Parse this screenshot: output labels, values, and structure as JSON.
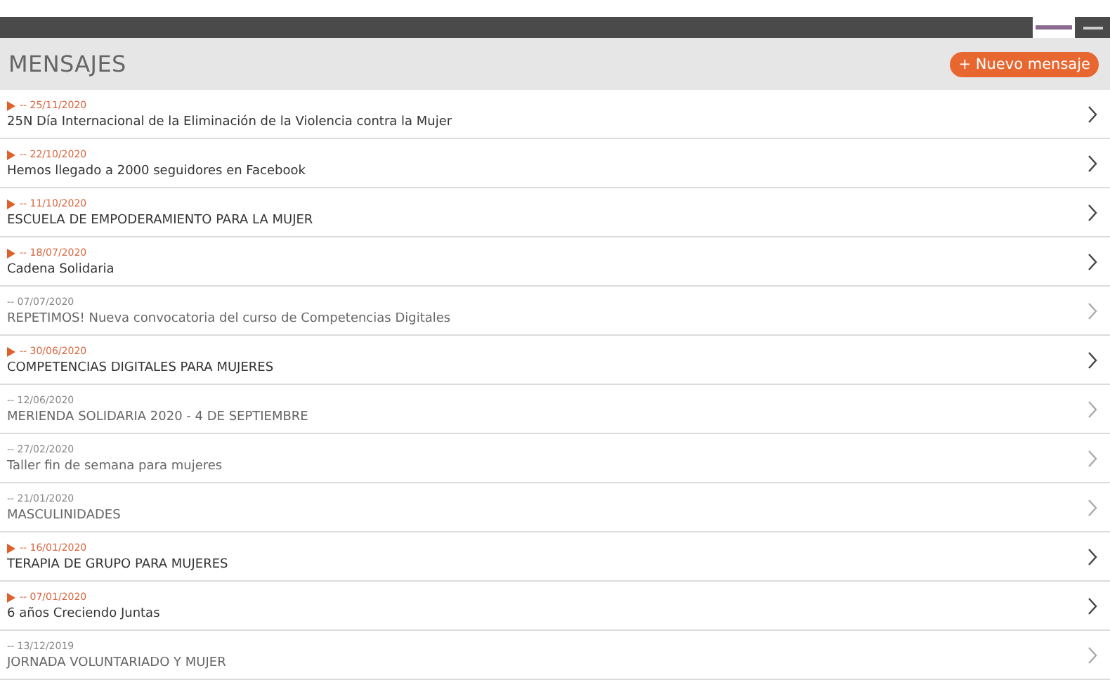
{
  "header": {
    "title": "MENSAJES",
    "new_button": "+ Nuevo mensaje"
  },
  "messages": [
    {
      "date": "-- 25/11/2020",
      "title": "25N Día Internacional de la Eliminación de la Violencia contra la Mujer",
      "unread": true
    },
    {
      "date": "-- 22/10/2020",
      "title": "Hemos llegado a 2000 seguidores en Facebook",
      "unread": true
    },
    {
      "date": "-- 11/10/2020",
      "title": "ESCUELA DE EMPODERAMIENTO PARA LA MUJER",
      "unread": true
    },
    {
      "date": "-- 18/07/2020",
      "title": "Cadena Solidaria",
      "unread": true
    },
    {
      "date": "-- 07/07/2020",
      "title": "REPETIMOS! Nueva convocatoria del curso de Competencias Digitales",
      "unread": false
    },
    {
      "date": "-- 30/06/2020",
      "title": "COMPETENCIAS DIGITALES PARA MUJERES",
      "unread": true
    },
    {
      "date": "-- 12/06/2020",
      "title": "MERIENDA SOLIDARIA 2020 - 4 DE SEPTIEMBRE",
      "unread": false
    },
    {
      "date": "-- 27/02/2020",
      "title": "Taller fin de semana para mujeres",
      "unread": false
    },
    {
      "date": "-- 21/01/2020",
      "title": "MASCULINIDADES",
      "unread": false
    },
    {
      "date": "-- 16/01/2020",
      "title": "TERAPIA DE GRUPO PARA MUJERES",
      "unread": true
    },
    {
      "date": "-- 07/01/2020",
      "title": "6 años Creciendo Juntas",
      "unread": true
    },
    {
      "date": "-- 13/12/2019",
      "title": "JORNADA VOLUNTARIADO Y MUJER",
      "unread": false
    }
  ]
}
